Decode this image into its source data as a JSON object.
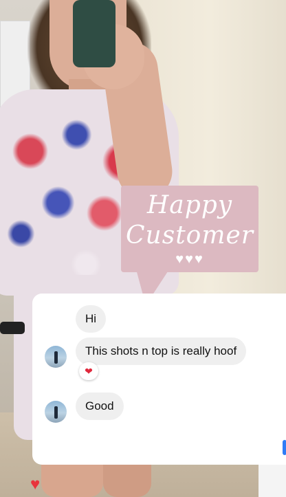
{
  "story": {
    "badge": {
      "line1": "Happy",
      "line2": "Customer",
      "hearts": "♥♥♥"
    }
  },
  "chat": {
    "messages": [
      {
        "text": "Hi"
      },
      {
        "text": "This shots n top is really hoof",
        "reaction": "❤"
      },
      {
        "text": "Good"
      }
    ]
  },
  "footer": {
    "like_icon": "heart-icon",
    "like_glyph": "♥"
  },
  "colors": {
    "badge_bg": "#dcb9c1",
    "bubble_bg": "#efefef",
    "like_red": "#e8343c"
  }
}
